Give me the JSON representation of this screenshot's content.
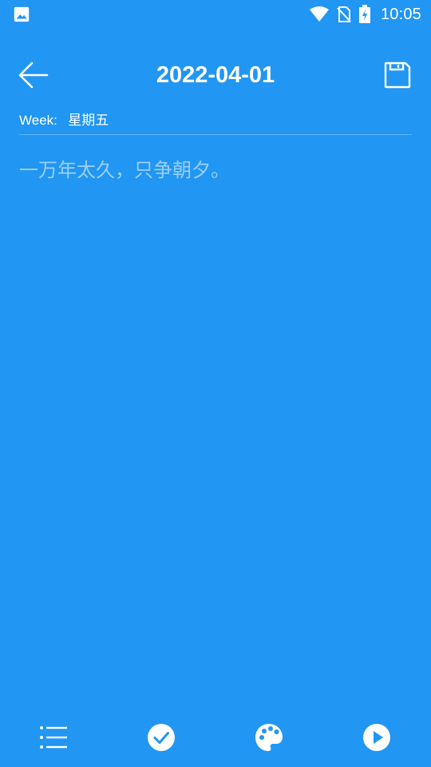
{
  "status_bar": {
    "time": "10:05",
    "icons": [
      "gallery-icon",
      "wifi-icon",
      "no-sim-icon",
      "battery-charging-icon"
    ]
  },
  "toolbar": {
    "back_icon": "arrow-left-icon",
    "title": "2022-04-01",
    "save_icon": "floppy-disk-icon"
  },
  "week": {
    "label": "Week:",
    "value": "星期五"
  },
  "editor": {
    "placeholder": "一万年太久，只争朝夕。"
  },
  "bottom_bar": {
    "icons": [
      "list-icon",
      "check-circle-icon",
      "palette-icon",
      "play-circle-icon"
    ]
  },
  "colors": {
    "background": "#2196F3",
    "foreground": "#FFFFFF"
  }
}
